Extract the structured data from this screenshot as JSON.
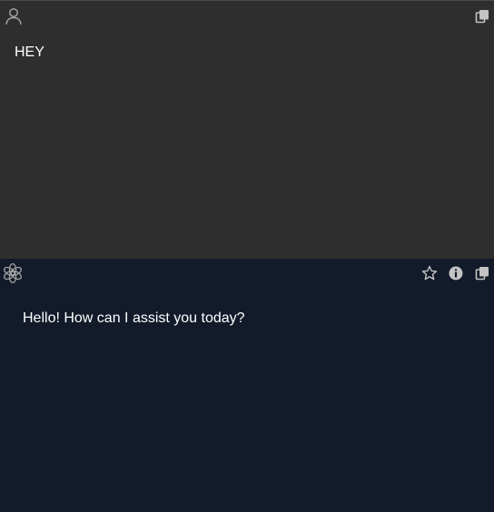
{
  "user_message": {
    "avatar_icon": "user-icon",
    "copy_icon": "copy-icon",
    "text": "HEY"
  },
  "assistant_message": {
    "avatar_icon": "openai-logo-icon",
    "favorite_icon": "star-icon",
    "info_icon": "info-icon",
    "copy_icon": "copy-icon",
    "text": "Hello! How can I assist you today?"
  },
  "colors": {
    "user_background": "#2e2e2e",
    "assistant_background": "#131b2b",
    "text": "#ffffff",
    "icon": "#b0b0b0"
  }
}
